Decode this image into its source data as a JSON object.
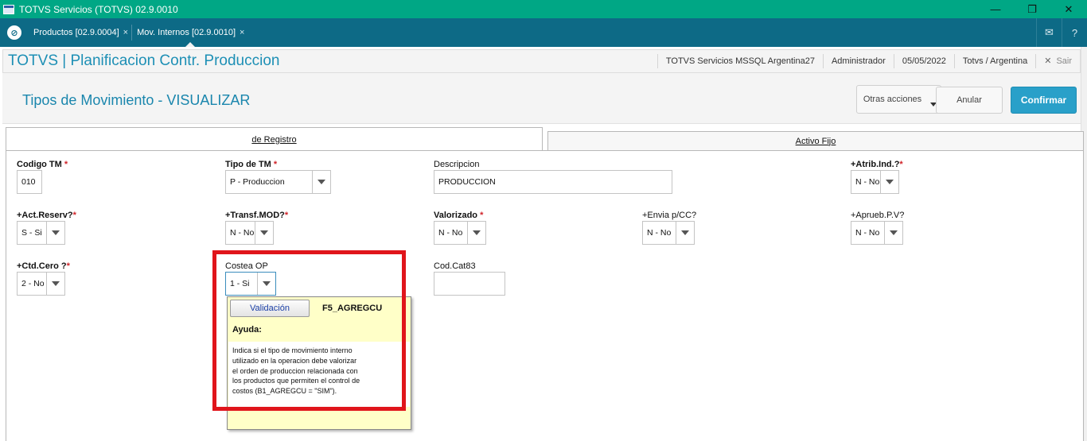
{
  "window": {
    "title": "TOTVS Servicios (TOTVS) 02.9.0010",
    "minimize": "—",
    "restore": "❐",
    "close": "✕"
  },
  "tabs": [
    {
      "label": "Productos [02.9.0004]",
      "close": "×"
    },
    {
      "label": "Mov. Internos [02.9.0010]",
      "close": "×"
    }
  ],
  "header": {
    "app_title": "TOTVS | Planificacion Contr. Produccion",
    "environment": "TOTVS Servicios MSSQL Argentina27",
    "user": "Administrador",
    "date": "05/05/2022",
    "company": "Totvs / Argentina",
    "exit_label": "Sair",
    "exit_icon": "✕"
  },
  "page": {
    "title": "Tipos de Movimiento - VISUALIZAR",
    "actions": {
      "otras": "Otras acciones",
      "anular": "Anular",
      "confirmar": "Confirmar"
    }
  },
  "folders": {
    "registro": "de Registro",
    "activo_fijo": "Activo Fijo"
  },
  "fields": {
    "codigo_tm": {
      "label": "Codigo TM",
      "req": "*",
      "value": "010"
    },
    "tipo_tm": {
      "label": "Tipo de TM",
      "req": "*",
      "value": "P - Produccion"
    },
    "descripcion": {
      "label": "Descripcion",
      "value": "PRODUCCION"
    },
    "atrib_ind": {
      "label": "+Atrib.Ind.?",
      "req": "*",
      "value": "N - No"
    },
    "act_reserv": {
      "label": "+Act.Reserv?",
      "req": "*",
      "value": "S - Si"
    },
    "transf_mod": {
      "label": "+Transf.MOD?",
      "req": "*",
      "value": "N - No"
    },
    "valorizado": {
      "label": "Valorizado",
      "req": "*",
      "value": "N - No"
    },
    "envia_pcc": {
      "label": "+Envia p/CC?",
      "value": "N - No"
    },
    "aprueb_pv": {
      "label": "+Aprueb.P.V?",
      "value": "N - No"
    },
    "ctd_cero": {
      "label": "+Ctd.Cero ?",
      "req": "*",
      "value": "2 - No"
    },
    "costea_op": {
      "label": "Costea OP",
      "value": "1 - Si"
    },
    "cod_cat83": {
      "label": "Cod.Cat83",
      "value": ""
    }
  },
  "tooltip": {
    "button": "Validación",
    "field_name": "F5_AGREGCU",
    "ayuda_label": "Ayuda:",
    "help_lines": [
      "Indica si el tipo de movimiento interno",
      "utilizado en la operacion debe valorizar",
      "el orden de produccion relacionada con",
      "los productos que permiten el control de",
      "costos (B1_AGREGCU = \"SIM\")."
    ]
  },
  "colors": {
    "titlebar": "#00a785",
    "tabbar": "#0d6a86",
    "accent": "#1d8fb5",
    "confirm": "#29a0c9",
    "required": "#d0242a",
    "highlight": "#e0151b",
    "tooltip_bg": "#ffffc8"
  },
  "icons": {
    "app": "app-window-icon",
    "logo": "totvs-logo-icon",
    "mail": "mail-icon",
    "help": "help-icon"
  }
}
